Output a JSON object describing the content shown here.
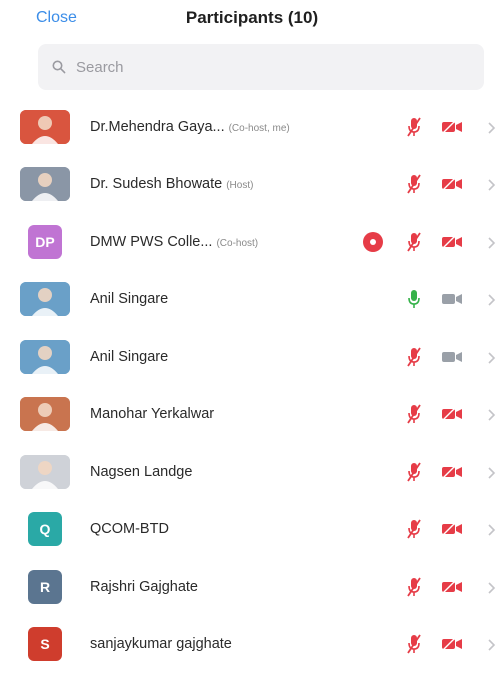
{
  "header": {
    "close_label": "Close",
    "title": "Participants (10)"
  },
  "search": {
    "placeholder": "Search"
  },
  "colors": {
    "accent_blue": "#3b8de8",
    "muted_red": "#e63c47",
    "unmuted_green": "#36b24a",
    "video_off_gray": "#9aa0a8"
  },
  "participants": [
    {
      "name": "Dr.Mehendra Gaya...",
      "tag": "(Co-host, me)",
      "avatar_text": "",
      "avatar_color": "#d9553f",
      "mic": "muted",
      "video": "off-red"
    },
    {
      "name": "Dr. Sudesh Bhowate",
      "tag": "(Host)",
      "avatar_text": "",
      "avatar_color": "#8a96a6",
      "mic": "muted",
      "video": "off-red"
    },
    {
      "name": "DMW PWS Colle...",
      "tag": "(Co-host)",
      "avatar_text": "DP",
      "avatar_color": "#c074d3",
      "mic": "muted",
      "video": "off-red",
      "badge": true
    },
    {
      "name": "Anil Singare",
      "tag": "",
      "avatar_text": "",
      "avatar_color": "#6aa0c8",
      "mic": "on",
      "video": "off-gray"
    },
    {
      "name": "Anil Singare",
      "tag": "",
      "avatar_text": "",
      "avatar_color": "#6aa0c8",
      "mic": "muted",
      "video": "off-gray"
    },
    {
      "name": "Manohar Yerkalwar",
      "tag": "",
      "avatar_text": "",
      "avatar_color": "#c9744f",
      "mic": "muted",
      "video": "off-red"
    },
    {
      "name": "Nagsen Landge",
      "tag": "",
      "avatar_text": "",
      "avatar_color": "#cfd2d8",
      "mic": "muted",
      "video": "off-red"
    },
    {
      "name": "QCOM-BTD",
      "tag": "",
      "avatar_text": "Q",
      "avatar_color": "#2aa9a6",
      "mic": "muted",
      "video": "off-red"
    },
    {
      "name": "Rajshri Gajghate",
      "tag": "",
      "avatar_text": "R",
      "avatar_color": "#5b7590",
      "mic": "muted",
      "video": "off-red"
    },
    {
      "name": "sanjaykumar gajghate",
      "tag": "",
      "avatar_text": "S",
      "avatar_color": "#cf3d2d",
      "mic": "muted",
      "video": "off-red"
    }
  ]
}
